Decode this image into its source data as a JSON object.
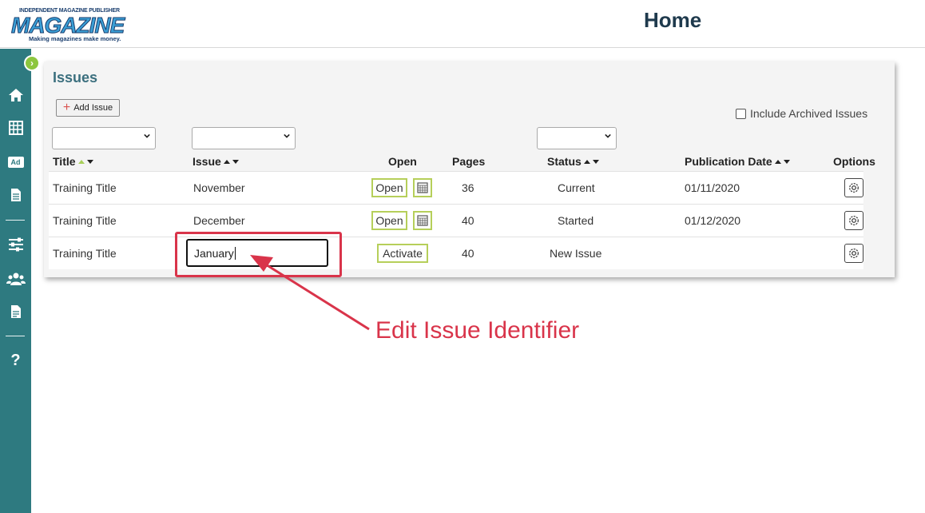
{
  "header": {
    "logo_top": "INDEPENDENT MAGAZINE PUBLISHER",
    "logo_main": "MAGAZINE",
    "logo_tagline": "Making magazines make money.",
    "page_title": "Home"
  },
  "sidebar": {
    "icons": [
      "home-icon",
      "grid-icon",
      "ad-icon",
      "document-icon",
      "sliders-icon",
      "users-icon",
      "report-icon",
      "help-icon"
    ],
    "ad_label": "Ad",
    "help_label": "?"
  },
  "issues": {
    "title": "Issues",
    "add_button": "Add Issue",
    "archived_label": "Include Archived Issues",
    "columns": {
      "title": "Title",
      "issue": "Issue",
      "open": "Open",
      "pages": "Pages",
      "status": "Status",
      "publication_date": "Publication Date",
      "options": "Options"
    },
    "rows": [
      {
        "title": "Training Title",
        "issue": "November",
        "action": "Open",
        "pages": "36",
        "status": "Current",
        "publication_date": "01/11/2020"
      },
      {
        "title": "Training Title",
        "issue": "December",
        "action": "Open",
        "pages": "40",
        "status": "Started",
        "publication_date": "01/12/2020"
      },
      {
        "title": "Training Title",
        "issue": "January",
        "action": "Activate",
        "pages": "40",
        "status": "New Issue",
        "publication_date": ""
      }
    ]
  },
  "annotation": {
    "label": "Edit Issue Identifier",
    "color": "#d9344a"
  },
  "colors": {
    "sidebar": "#2e7a80",
    "accent_green": "#b6cf5a",
    "title_teal": "#3b6f7e"
  }
}
